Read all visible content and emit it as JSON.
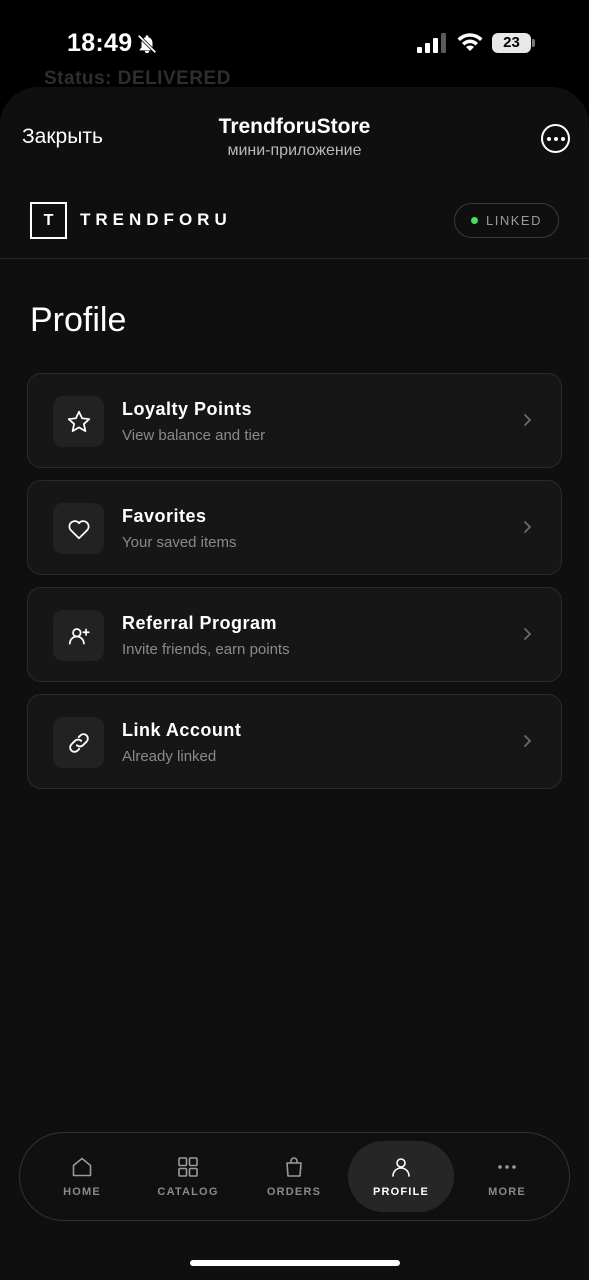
{
  "status_bar": {
    "time": "18:49",
    "battery": "23",
    "icons": [
      "bell-slash-icon",
      "signal-icon",
      "wifi-icon",
      "battery-icon"
    ]
  },
  "background_text": "Status: DELIVERED",
  "telegram_header": {
    "close_label": "Закрыть",
    "title": "TrendforuStore",
    "subtitle": "мини-приложение"
  },
  "app_header": {
    "logo_letter": "T",
    "logo_text": "TRENDFORU",
    "badge": "LINKED",
    "badge_color": "#4cd964"
  },
  "page": {
    "title": "Profile"
  },
  "menu": [
    {
      "title": "Loyalty Points",
      "subtitle": "View balance and tier",
      "icon": "star-icon"
    },
    {
      "title": "Favorites",
      "subtitle": "Your saved items",
      "icon": "heart-icon"
    },
    {
      "title": "Referral Program",
      "subtitle": "Invite friends, earn points",
      "icon": "user-plus-icon"
    },
    {
      "title": "Link Account",
      "subtitle": "Already linked",
      "icon": "link-icon"
    }
  ],
  "bottom_nav": {
    "active": "PROFILE",
    "items": [
      {
        "label": "HOME",
        "icon": "home-icon"
      },
      {
        "label": "CATALOG",
        "icon": "grid-icon"
      },
      {
        "label": "ORDERS",
        "icon": "bag-icon"
      },
      {
        "label": "PROFILE",
        "icon": "user-icon"
      },
      {
        "label": "MORE",
        "icon": "dots-icon"
      }
    ]
  }
}
